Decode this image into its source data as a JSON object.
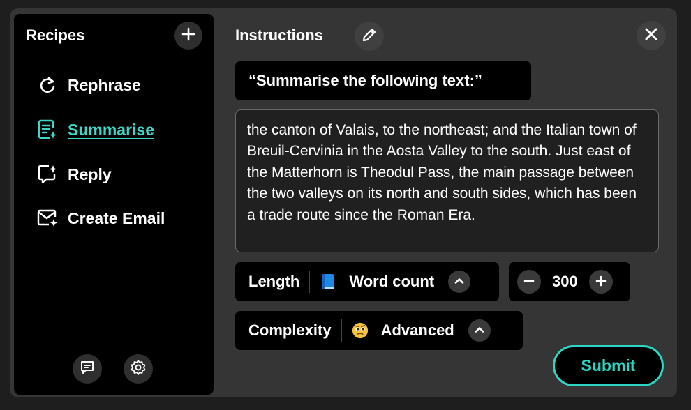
{
  "sidebar": {
    "title": "Recipes",
    "add_icon": "plus-icon",
    "items": [
      {
        "label": "Rephrase",
        "icon": "rephrase-icon",
        "active": false
      },
      {
        "label": "Summarise",
        "icon": "summarise-icon",
        "active": true
      },
      {
        "label": "Reply",
        "icon": "reply-icon",
        "active": false
      },
      {
        "label": "Create Email",
        "icon": "create-email-icon",
        "active": false
      }
    ],
    "bottom_icons": [
      "feedback-icon",
      "gear-icon"
    ]
  },
  "main": {
    "title": "Instructions",
    "edit_icon": "pencil-icon",
    "close_icon": "close-icon",
    "prompt": "“Summarise the following text:”",
    "text": "the canton of Valais, to the northeast; and the Italian town of Breuil-Cervinia in the Aosta Valley to the south. Just east of the Matterhorn is Theodul Pass, the main passage between the two valleys on its north and south sides, which has been a trade route since the Roman Era.",
    "length": {
      "label": "Length",
      "icon": "book-icon",
      "value": "Word count"
    },
    "word_count": {
      "value": "300"
    },
    "complexity": {
      "label": "Complexity",
      "icon": "thinking-face-icon",
      "value": "Advanced"
    },
    "submit_label": "Submit"
  },
  "colors": {
    "accent": "#2bd6c5",
    "panel": "#353535",
    "sidebar": "#000000"
  }
}
